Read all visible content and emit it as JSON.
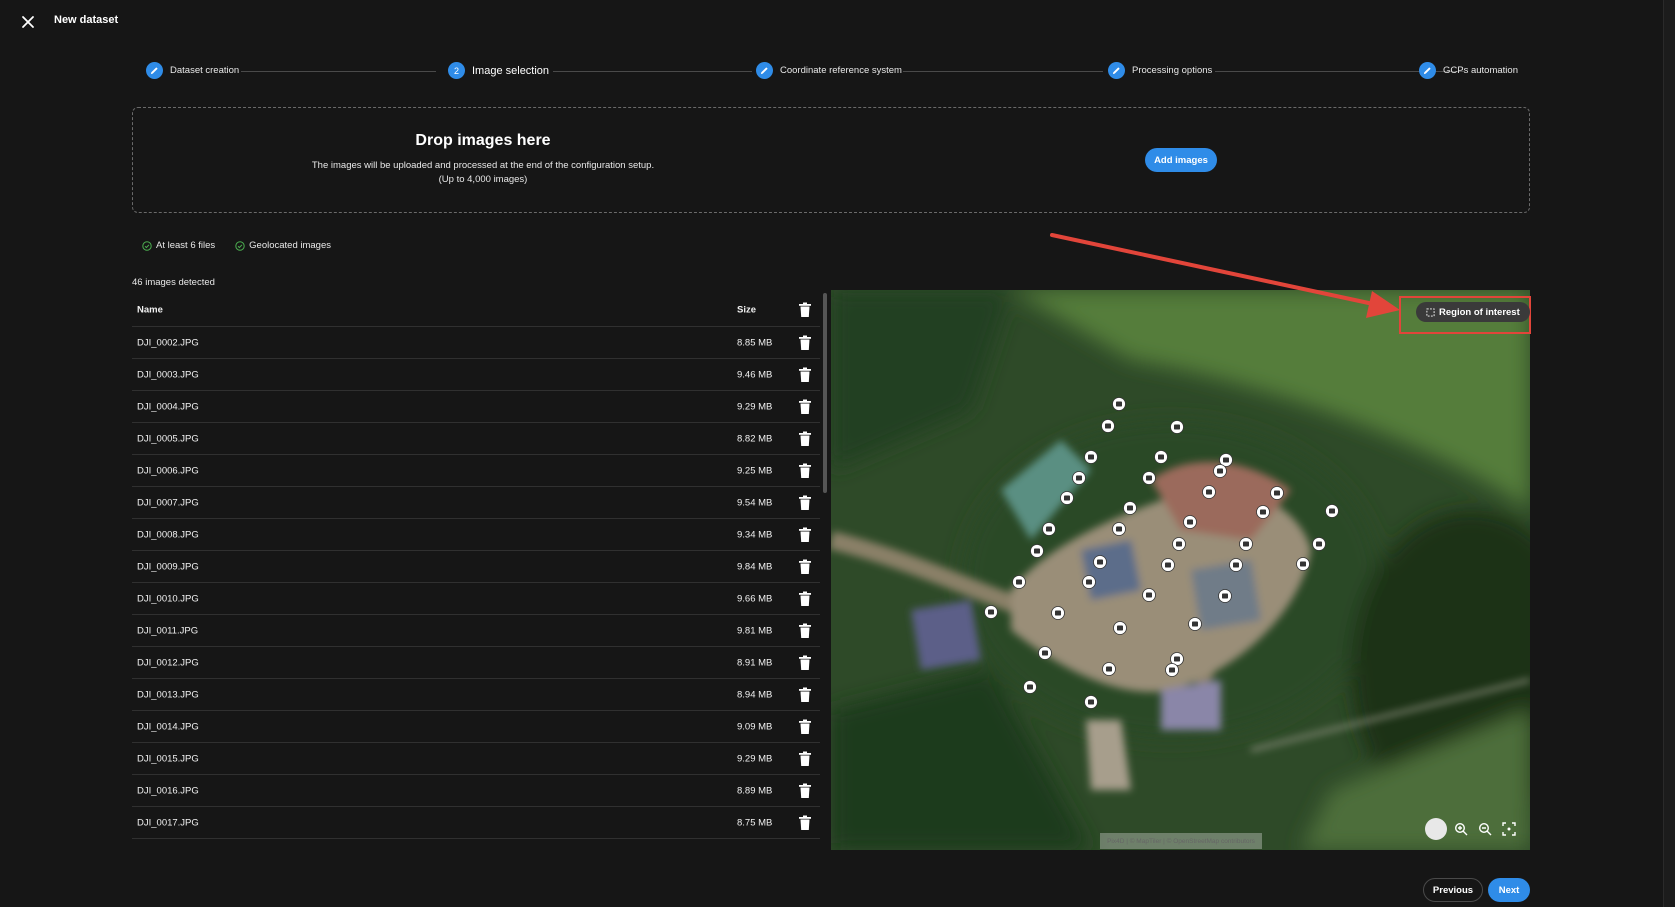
{
  "header": {
    "title": "New dataset"
  },
  "stepper": {
    "steps": [
      {
        "label": "Dataset creation",
        "state": "done"
      },
      {
        "label": "Image selection",
        "state": "active",
        "number": "2"
      },
      {
        "label": "Coordinate reference system",
        "state": "done"
      },
      {
        "label": "Processing options",
        "state": "done"
      },
      {
        "label": "GCPs automation",
        "state": "done"
      }
    ]
  },
  "dropzone": {
    "title": "Drop images here",
    "subtitle": "The images will be uploaded and processed at the end of the configuration setup.",
    "limit": "(Up to 4,000 images)",
    "add_button": "Add images"
  },
  "requirements": [
    {
      "label": "At least 6 files",
      "met": true
    },
    {
      "label": "Geolocated images",
      "met": true
    }
  ],
  "images_detected": "46 images detected",
  "table": {
    "columns": {
      "name": "Name",
      "size": "Size"
    },
    "rows": [
      {
        "name": "DJI_0002.JPG",
        "size": "8.85 MB"
      },
      {
        "name": "DJI_0003.JPG",
        "size": "9.46 MB"
      },
      {
        "name": "DJI_0004.JPG",
        "size": "9.29 MB"
      },
      {
        "name": "DJI_0005.JPG",
        "size": "8.82 MB"
      },
      {
        "name": "DJI_0006.JPG",
        "size": "9.25 MB"
      },
      {
        "name": "DJI_0007.JPG",
        "size": "9.54 MB"
      },
      {
        "name": "DJI_0008.JPG",
        "size": "9.34 MB"
      },
      {
        "name": "DJI_0009.JPG",
        "size": "9.84 MB"
      },
      {
        "name": "DJI_0010.JPG",
        "size": "9.66 MB"
      },
      {
        "name": "DJI_0011.JPG",
        "size": "9.81 MB"
      },
      {
        "name": "DJI_0012.JPG",
        "size": "8.91 MB"
      },
      {
        "name": "DJI_0013.JPG",
        "size": "8.94 MB"
      },
      {
        "name": "DJI_0014.JPG",
        "size": "9.09 MB"
      },
      {
        "name": "DJI_0015.JPG",
        "size": "9.29 MB"
      },
      {
        "name": "DJI_0016.JPG",
        "size": "8.89 MB"
      },
      {
        "name": "DJI_0017.JPG",
        "size": "8.75 MB"
      }
    ]
  },
  "map": {
    "roi_button": "Region of interest",
    "attribution": "Pix4D | © MapTiler | © OpenStreetMap contributors",
    "highlight_color": "#e2453a"
  },
  "footer": {
    "previous": "Previous",
    "next": "Next"
  },
  "colors": {
    "accent": "#2f8ce8",
    "background": "#161616",
    "success": "#4caf50"
  }
}
